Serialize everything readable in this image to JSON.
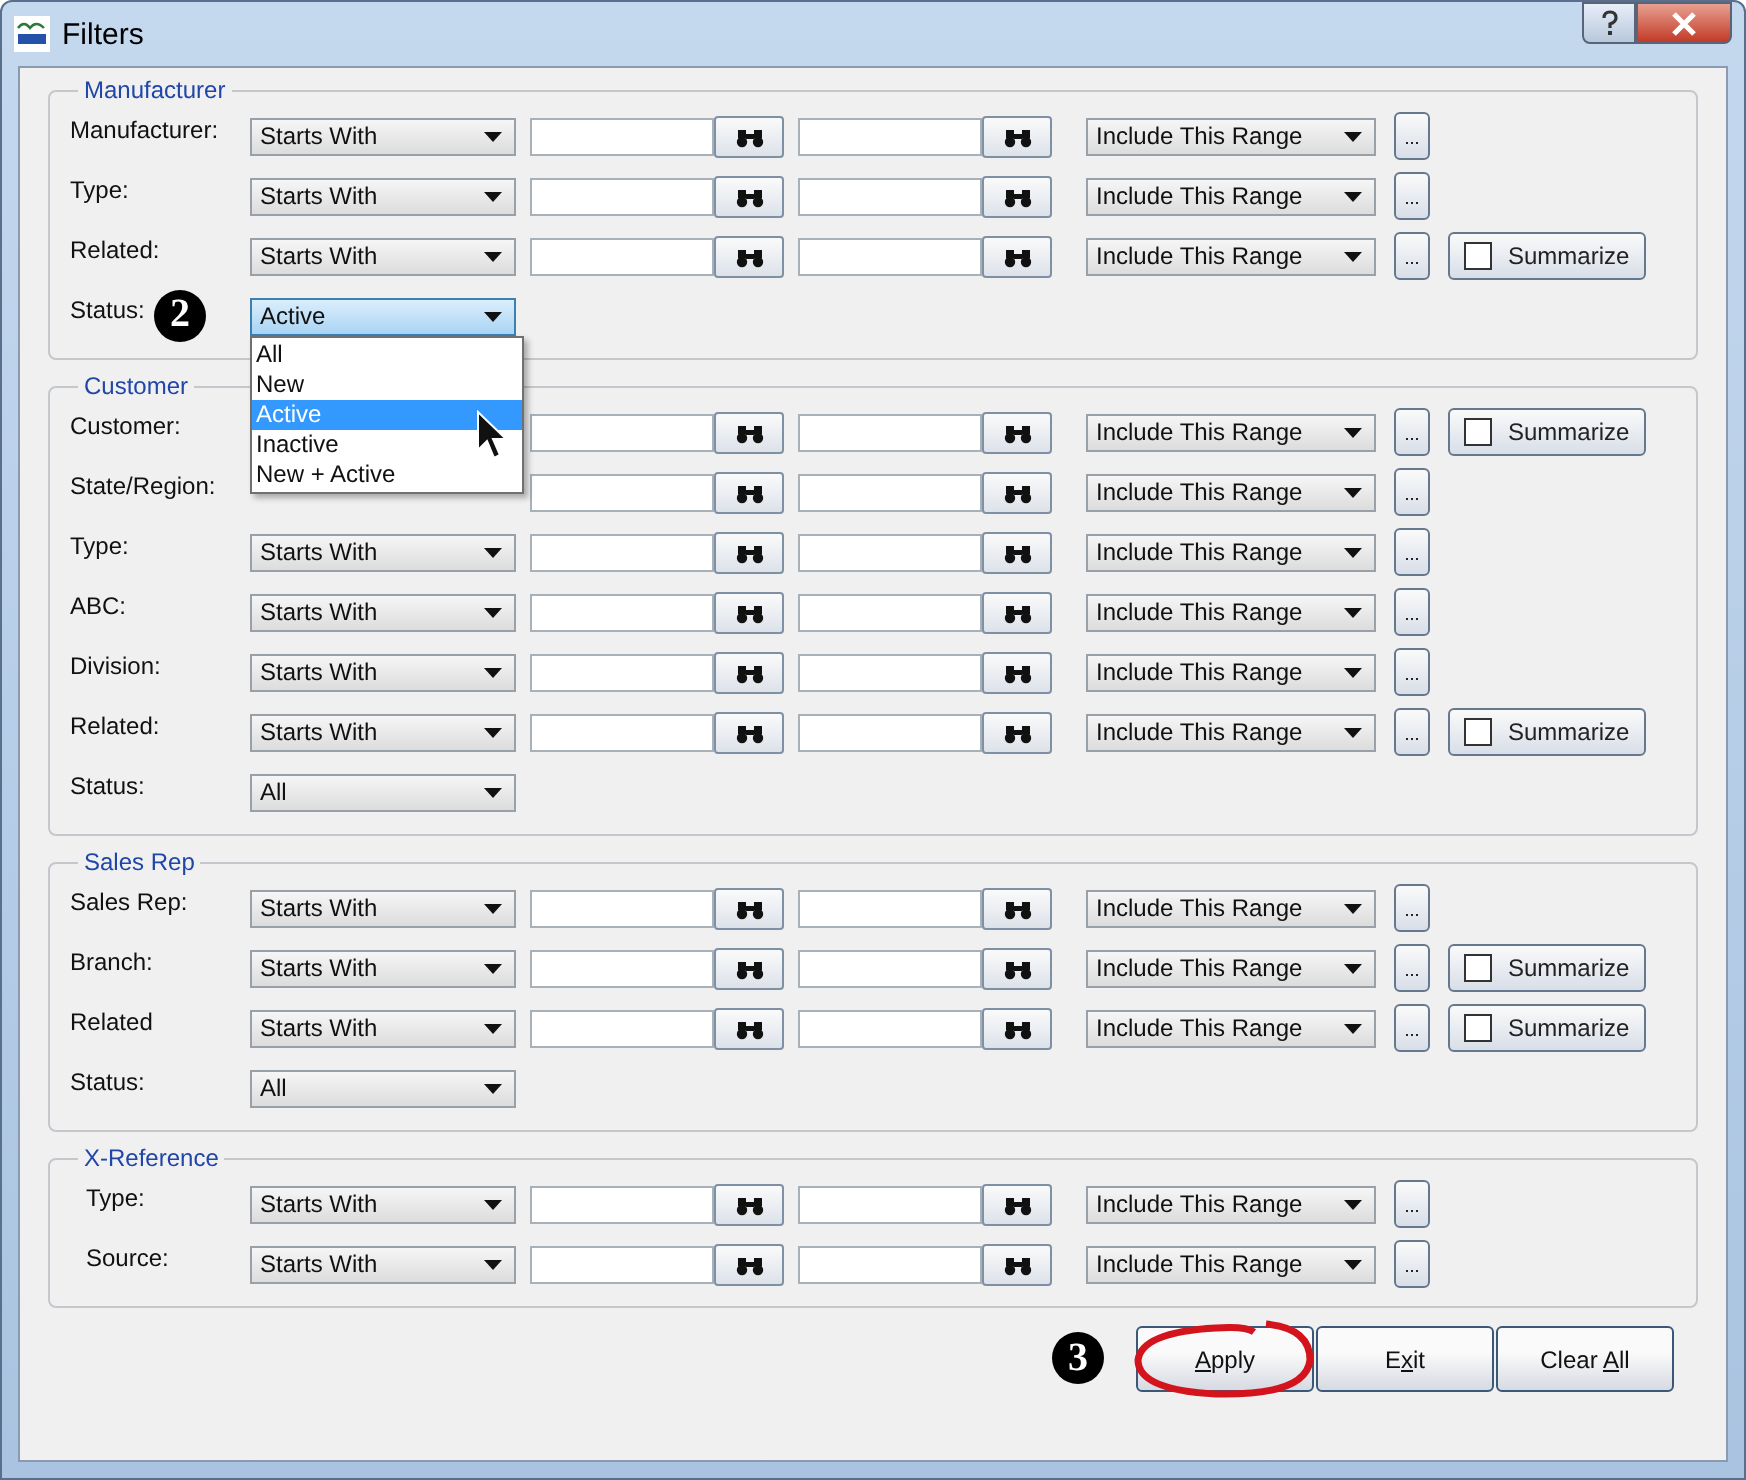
{
  "window": {
    "title": "Filters"
  },
  "sections": [
    {
      "title": "Manufacturer",
      "rows": [
        {
          "kind": "range",
          "label": "Manufacturer:",
          "match": "Starts With",
          "range": "Include This Range",
          "more": "..."
        },
        {
          "kind": "range",
          "label": "Type:",
          "match": "Starts With",
          "range": "Include This Range",
          "more": "..."
        },
        {
          "kind": "range",
          "label": "Related:",
          "match": "Starts With",
          "range": "Include This Range",
          "more": "...",
          "summarize": {
            "label": "Summarize",
            "checked": false
          }
        },
        {
          "kind": "status",
          "label": "Status:",
          "value": "Active",
          "badge": "2",
          "expanded": true,
          "options": [
            {
              "label": "All",
              "selected": false
            },
            {
              "label": "New",
              "selected": false
            },
            {
              "label": "Active",
              "selected": true
            },
            {
              "label": "Inactive",
              "selected": false
            },
            {
              "label": "New + Active",
              "selected": false
            }
          ]
        }
      ]
    },
    {
      "title": "Customer",
      "rows": [
        {
          "kind": "range",
          "label": "Customer:",
          "range": "Include This Range",
          "more": "...",
          "summarize": {
            "label": "Summarize",
            "checked": false
          }
        },
        {
          "kind": "range",
          "label": "State/Region:",
          "range": "Include This Range",
          "more": "..."
        },
        {
          "kind": "range",
          "label": "Type:",
          "match": "Starts With",
          "range": "Include This Range",
          "more": "..."
        },
        {
          "kind": "range",
          "label": "ABC:",
          "match": "Starts With",
          "range": "Include This Range",
          "more": "..."
        },
        {
          "kind": "range",
          "label": "Division:",
          "match": "Starts With",
          "range": "Include This Range",
          "more": "..."
        },
        {
          "kind": "range",
          "label": "Related:",
          "match": "Starts With",
          "range": "Include This Range",
          "more": "...",
          "summarize": {
            "label": "Summarize",
            "checked": false
          }
        },
        {
          "kind": "status",
          "label": "Status:",
          "value": "All",
          "expanded": false
        }
      ]
    },
    {
      "title": "Sales Rep",
      "rows": [
        {
          "kind": "range",
          "label": "Sales Rep:",
          "match": "Starts With",
          "range": "Include This Range",
          "more": "..."
        },
        {
          "kind": "range",
          "label": "Branch:",
          "match": "Starts With",
          "range": "Include This Range",
          "more": "...",
          "summarize": {
            "label": "Summarize",
            "checked": false
          }
        },
        {
          "kind": "range",
          "label": "Related",
          "match": "Starts With",
          "range": "Include This Range",
          "more": "...",
          "summarize": {
            "label": "Summarize",
            "checked": false
          }
        },
        {
          "kind": "status",
          "label": "Status:",
          "value": "All",
          "expanded": false
        }
      ]
    },
    {
      "title": "X-Reference",
      "rows": [
        {
          "kind": "range",
          "label": "Type:",
          "match": "Starts With",
          "range": "Include This Range",
          "more": "..."
        },
        {
          "kind": "range",
          "label": "Source:",
          "match": "Starts With",
          "range": "Include This Range",
          "more": "..."
        }
      ]
    }
  ],
  "footer": {
    "badge": "3",
    "buttons": [
      {
        "key": "A",
        "after": "pply",
        "highlighted": true
      },
      {
        "before": "E",
        "key": "x",
        "after": "it",
        "highlighted": false
      },
      {
        "before": "Clear ",
        "key": "A",
        "after": "ll",
        "highlighted": false
      }
    ]
  }
}
